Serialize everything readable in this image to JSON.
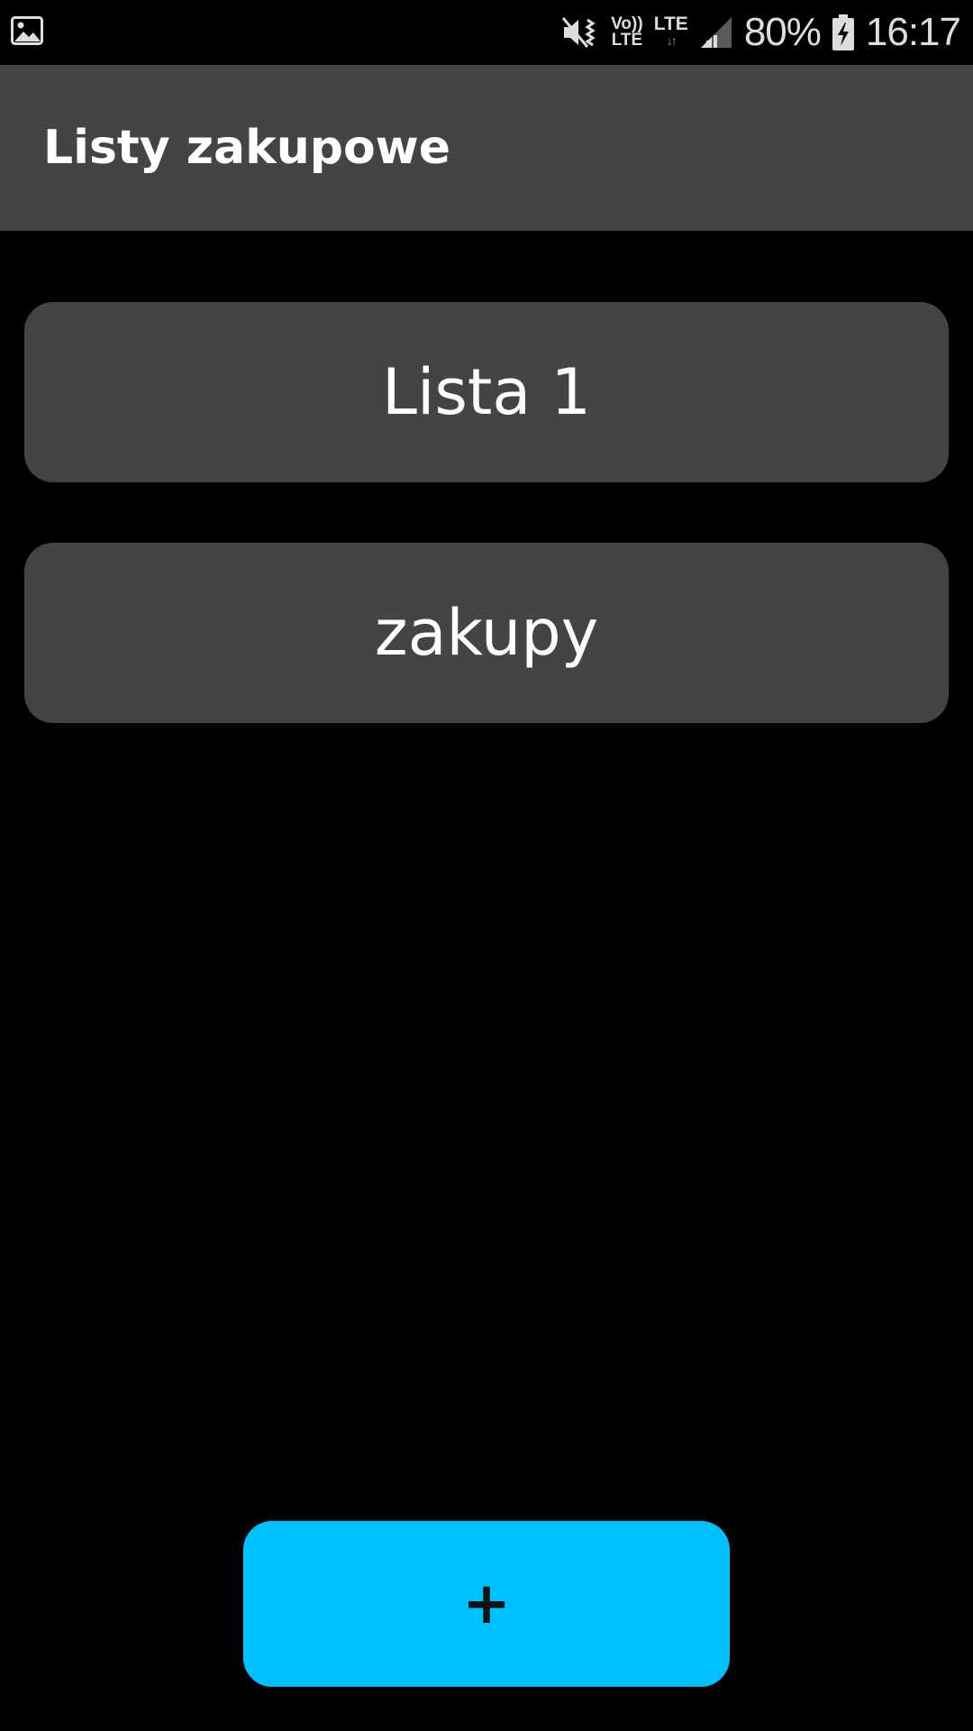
{
  "status_bar": {
    "notification_icon": "image-icon",
    "mute_icon": "vibrate-mute-icon",
    "volte_top": "Vo))",
    "volte_bottom": "LTE",
    "lte_label": "LTE",
    "lte_arrows": "↓↑",
    "signal_icon": "signal-icon",
    "battery_percent": "80%",
    "battery_icon": "battery-charging-icon",
    "time": "16:17"
  },
  "app_bar": {
    "title": "Listy zakupowe"
  },
  "lists": [
    {
      "label": "Lista 1"
    },
    {
      "label": "zakupy"
    }
  ],
  "add_button": {
    "label": "+"
  },
  "colors": {
    "background": "#000000",
    "surface": "#444444",
    "accent": "#00bfff",
    "text": "#ffffff"
  }
}
